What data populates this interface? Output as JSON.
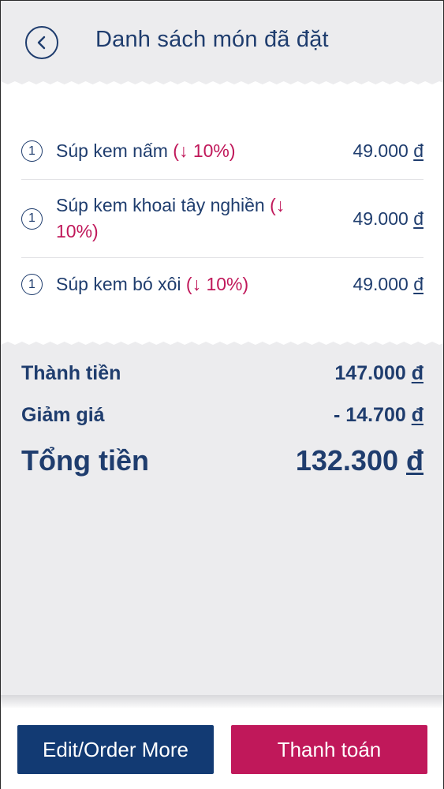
{
  "header": {
    "back_icon": "chevron-left-icon",
    "title": "Danh sách món đã đặt"
  },
  "items": [
    {
      "qty": "1",
      "name": "Súp kem nấm ",
      "discount": "(↓ 10%)",
      "price": "49.000 ",
      "currency": "đ"
    },
    {
      "qty": "1",
      "name": "Súp kem khoai tây nghiền ",
      "discount": "(↓ 10%)",
      "price": "49.000 ",
      "currency": "đ"
    },
    {
      "qty": "1",
      "name": "Súp kem bó xôi ",
      "discount": "(↓ 10%)",
      "price": "49.000 ",
      "currency": "đ"
    }
  ],
  "summary": {
    "subtotal_label": "Thành tiền",
    "subtotal_value": "147.000 ",
    "discount_label": "Giảm giá",
    "discount_value": "- 14.700 ",
    "total_label": "Tổng tiền",
    "total_value": "132.300 ",
    "currency": "đ"
  },
  "actions": {
    "edit_label": "Edit/Order More",
    "pay_label": "Thanh toán"
  },
  "colors": {
    "primary": "#1f3d6e",
    "accent": "#c0185a",
    "button_dark": "#123a73"
  }
}
